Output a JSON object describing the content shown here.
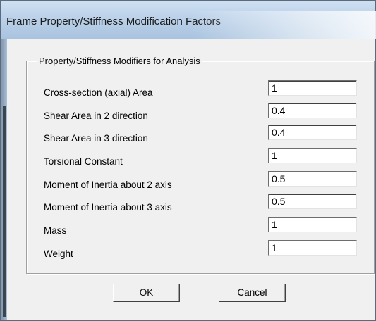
{
  "window": {
    "title": "Frame Property/Stiffness Modification Factors"
  },
  "group": {
    "legend": "Property/Stiffness Modifiers for Analysis",
    "rows": [
      {
        "label": "Cross-section (axial) Area",
        "value": "1"
      },
      {
        "label": "Shear Area in 2 direction",
        "value": "0.4"
      },
      {
        "label": "Shear Area in 3 direction",
        "value": "0.4"
      },
      {
        "label": "Torsional Constant",
        "value": "1"
      },
      {
        "label": "Moment of Inertia about 2 axis",
        "value": "0.5"
      },
      {
        "label": "Moment of Inertia about 3 axis",
        "value": "0.5"
      },
      {
        "label": "Mass",
        "value": "1"
      },
      {
        "label": "Weight",
        "value": "1"
      }
    ]
  },
  "buttons": {
    "ok_label": "OK",
    "cancel_label": "Cancel"
  }
}
